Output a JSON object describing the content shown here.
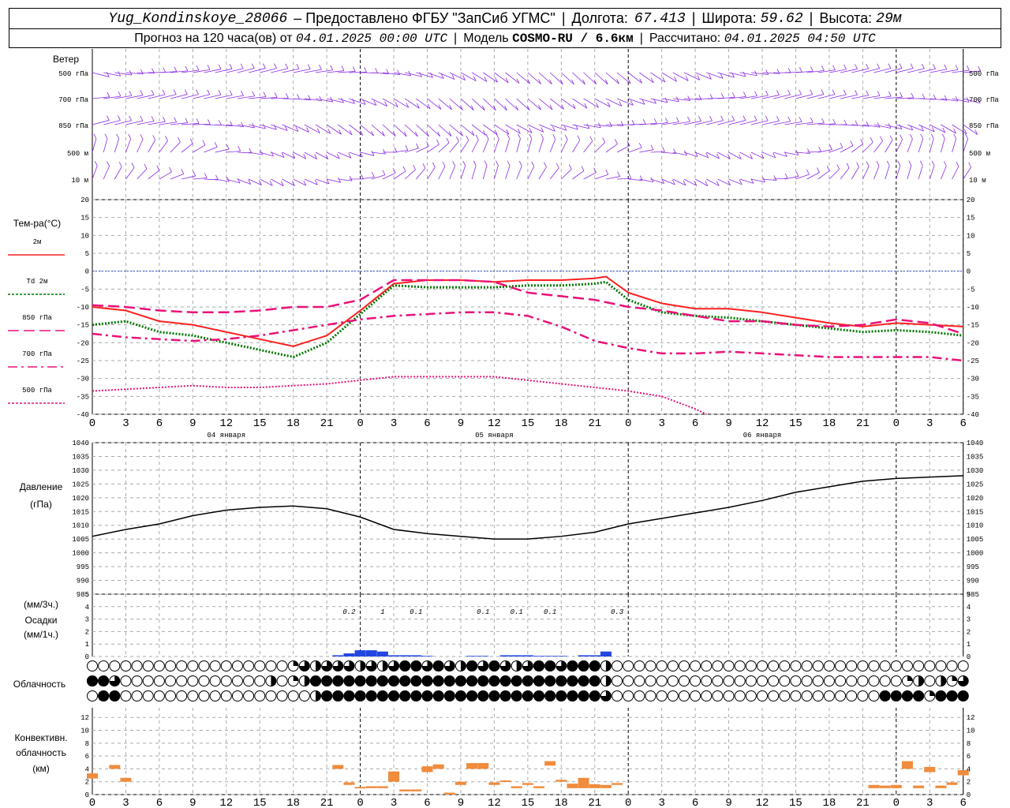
{
  "header": {
    "station": "Yug_Kondinskoye_28066",
    "provided_by": "– Предоставлено ФГБУ \"ЗапСиб УГМС\"",
    "lon_label": "Долгота:",
    "lon": "67.413",
    "lat_label": "Широта:",
    "lat": "59.62",
    "alt_label": "Высота:",
    "alt": "29м",
    "forecast_label": "Прогноз на 120 часа(ов) от",
    "forecast_from": "04.01.2025 00:00 UTC",
    "model_label": "Модель",
    "model": "COSMO-RU / 6.6км",
    "calc_label": "Рассчитано:",
    "calc_time": "04.01.2025 04:50 UTC"
  },
  "wind": {
    "title": "Ветер",
    "levels": [
      "500 гПа",
      "700 гПа",
      "850 гПа",
      "500 м",
      "10 м"
    ]
  },
  "temperature": {
    "title": "Тем-ра(°C)",
    "legend": [
      {
        "label": "2м",
        "color": "#ff2020"
      },
      {
        "label": "Td  2м",
        "color": "#007700"
      },
      {
        "label": "850 гПа",
        "color": "#e8127a"
      },
      {
        "label": "700 гПа",
        "color": "#e8127a"
      },
      {
        "label": "500 гПа",
        "color": "#e8127a"
      }
    ]
  },
  "pressure": {
    "title1": "Давление",
    "title2": "(гПа)"
  },
  "precip": {
    "title1": "(мм/3ч.)",
    "title2": "Осадки",
    "title3": "(мм/1ч.)",
    "labels": [
      {
        "h": 23,
        "text": "0.2"
      },
      {
        "h": 26,
        "text": "1"
      },
      {
        "h": 29,
        "text": "0.1"
      },
      {
        "h": 35,
        "text": "0.1"
      },
      {
        "h": 38,
        "text": "0.1"
      },
      {
        "h": 41,
        "text": "0.1"
      },
      {
        "h": 47,
        "text": "0.3"
      }
    ]
  },
  "cloud": {
    "title": "Облачность"
  },
  "convective": {
    "title1": "Конвективн.",
    "title2": "облачность",
    "title3": "(км)"
  },
  "days": [
    {
      "h": 12,
      "label": "04 января"
    },
    {
      "h": 36,
      "label": "05 января"
    },
    {
      "h": 60,
      "label": "06 января"
    }
  ],
  "x_ticks": [
    "0",
    "3",
    "6",
    "9",
    "12",
    "15",
    "18",
    "21",
    "0",
    "3",
    "6",
    "9",
    "12",
    "15",
    "18",
    "21",
    "0",
    "3",
    "6",
    "9",
    "12",
    "15",
    "18",
    "21",
    "0",
    "3",
    "6"
  ],
  "chart_data": [
    {
      "type": "line",
      "name": "temperature",
      "ylim": [
        -40,
        20
      ],
      "yticks": [
        20,
        15,
        10,
        5,
        0,
        -5,
        -10,
        -15,
        -20,
        -25,
        -30,
        -35,
        -40
      ],
      "series": [
        {
          "name": "2м",
          "color": "#ff2020",
          "style": "solid",
          "x": [
            0,
            3,
            6,
            9,
            12,
            15,
            18,
            21,
            24,
            27,
            30,
            33,
            36,
            39,
            42,
            45,
            46,
            48,
            51,
            54,
            57,
            60,
            63,
            66,
            69,
            72,
            75,
            78
          ],
          "y": [
            -10,
            -11,
            -14,
            -15,
            -17,
            -19,
            -21,
            -18,
            -11,
            -3.5,
            -2.5,
            -2.5,
            -3,
            -2.5,
            -2.5,
            -2,
            -1.5,
            -6,
            -9,
            -10.5,
            -10.5,
            -11.5,
            -13,
            -14.5,
            -15.5,
            -14.5,
            -15,
            -15.5
          ]
        },
        {
          "name": "Td 2м",
          "color": "#007700",
          "style": "dotted",
          "x": [
            0,
            3,
            6,
            9,
            12,
            15,
            18,
            21,
            24,
            27,
            30,
            33,
            36,
            39,
            42,
            45,
            46,
            48,
            51,
            54,
            57,
            60,
            63,
            66,
            69,
            72,
            75,
            78
          ],
          "y": [
            -15,
            -14,
            -17,
            -18,
            -20,
            -22,
            -24,
            -20,
            -12,
            -4,
            -4.5,
            -4.5,
            -4.5,
            -4,
            -4,
            -3.5,
            -3,
            -8,
            -11.5,
            -12.5,
            -13,
            -14,
            -15,
            -16,
            -17,
            -16.5,
            -17,
            -18
          ]
        },
        {
          "name": "850 гПа",
          "color": "#e8127a",
          "style": "longdash",
          "x": [
            0,
            3,
            6,
            9,
            12,
            15,
            18,
            21,
            24,
            27,
            30,
            33,
            36,
            39,
            42,
            45,
            48,
            51,
            54,
            57,
            60,
            63,
            66,
            69,
            72,
            75,
            78
          ],
          "y": [
            -9.5,
            -10,
            -11,
            -11.5,
            -11.5,
            -11,
            -10,
            -10,
            -8,
            -2.5,
            -2.5,
            -2.5,
            -3,
            -6,
            -7,
            -8,
            -10,
            -11,
            -12.5,
            -14,
            -14,
            -15,
            -15.5,
            -15,
            -13.5,
            -14.5,
            -17.5
          ]
        },
        {
          "name": "700 гПа",
          "color": "#e8127a",
          "style": "dashdot",
          "x": [
            0,
            3,
            6,
            9,
            12,
            15,
            18,
            21,
            24,
            27,
            30,
            33,
            36,
            39,
            42,
            45,
            48,
            51,
            54,
            57,
            60,
            63,
            66,
            69,
            72,
            75,
            78
          ],
          "y": [
            -17.5,
            -18.5,
            -19,
            -19.5,
            -19,
            -18,
            -16.5,
            -15,
            -13.5,
            -12.5,
            -12,
            -11.5,
            -11.5,
            -12.5,
            -15.5,
            -19.5,
            -21.5,
            -23,
            -23,
            -22.5,
            -23,
            -23.5,
            -24,
            -24,
            -24,
            -24,
            -25
          ]
        },
        {
          "name": "500 гПа",
          "color": "#e8127a",
          "style": "dotted",
          "x": [
            0,
            3,
            6,
            9,
            12,
            15,
            18,
            21,
            24,
            27,
            30,
            33,
            36,
            39,
            42,
            45,
            48,
            51,
            54,
            55
          ],
          "y": [
            -33.5,
            -33,
            -32.5,
            -32,
            -32.5,
            -32.5,
            -32,
            -31.5,
            -30.5,
            -29.5,
            -29.5,
            -29.5,
            -29.5,
            -30.5,
            -31.5,
            -32.5,
            -33.5,
            -35,
            -38.5,
            -40
          ]
        }
      ]
    },
    {
      "type": "line",
      "name": "pressure",
      "ylim": [
        985,
        1040
      ],
      "yticks": [
        1040,
        1035,
        1030,
        1025,
        1020,
        1015,
        1010,
        1005,
        1000,
        995,
        990,
        985
      ],
      "series": [
        {
          "name": "Давление",
          "color": "#000000",
          "x": [
            0,
            3,
            6,
            9,
            12,
            15,
            18,
            21,
            24,
            27,
            30,
            33,
            36,
            39,
            42,
            45,
            48,
            51,
            54,
            57,
            60,
            63,
            66,
            69,
            72,
            75,
            78
          ],
          "y": [
            1006,
            1008.5,
            1010.5,
            1013.5,
            1015.5,
            1016.5,
            1017,
            1016,
            1013,
            1008.5,
            1007,
            1006,
            1005,
            1005,
            1006,
            1007.5,
            1010.5,
            1012.5,
            1014.5,
            1016.5,
            1019,
            1022,
            1024,
            1026,
            1027,
            1027.5,
            1028
          ]
        }
      ]
    },
    {
      "type": "bar",
      "name": "precipitation",
      "ylim": [
        0,
        5
      ],
      "yticks": [
        5,
        4,
        3,
        2,
        1,
        0
      ],
      "color": "#2246e0",
      "series": [
        {
          "name": "Осадки",
          "x": [
            22,
            23,
            24,
            25,
            26,
            27,
            28,
            29,
            30,
            34,
            35,
            37,
            38,
            39,
            40,
            41,
            42,
            44,
            45,
            46
          ],
          "y": [
            0.1,
            0.25,
            0.5,
            0.5,
            0.4,
            0.1,
            0.1,
            0.1,
            0.05,
            0.05,
            0.05,
            0.1,
            0.1,
            0.1,
            0.05,
            0.05,
            0.05,
            0.1,
            0.1,
            0.4
          ]
        }
      ]
    },
    {
      "type": "table",
      "name": "cloudiness",
      "rows": [
        {
          "name": "высокая",
          "x_start": 0,
          "x_step": 1,
          "values": [
            0,
            0,
            0,
            0,
            0,
            0,
            0,
            0,
            0,
            0,
            0,
            0,
            0,
            0,
            0,
            0,
            0,
            0,
            1,
            3,
            2,
            3,
            3,
            3,
            2,
            3,
            2,
            3,
            4,
            4,
            3,
            4,
            3,
            2,
            4,
            3,
            4,
            3,
            2,
            3,
            4,
            4,
            3,
            4,
            4,
            4,
            2,
            0,
            0,
            0,
            0,
            0,
            0,
            0,
            0,
            0,
            0,
            0,
            0,
            0,
            0,
            0,
            0,
            0,
            0,
            0,
            0,
            0,
            0,
            0,
            0,
            0,
            0,
            0,
            0,
            0,
            0,
            0,
            0
          ]
        },
        {
          "name": "средняя",
          "x_start": 0,
          "x_step": 1,
          "values": [
            4,
            4,
            3,
            0,
            0,
            0,
            0,
            0,
            0,
            0,
            0,
            0,
            0,
            0,
            0,
            0,
            2,
            0,
            1,
            2,
            4,
            4,
            4,
            4,
            4,
            4,
            4,
            4,
            4,
            4,
            4,
            4,
            4,
            4,
            4,
            4,
            4,
            4,
            4,
            4,
            4,
            4,
            4,
            4,
            4,
            4,
            2,
            0,
            0,
            0,
            0,
            0,
            0,
            0,
            0,
            0,
            0,
            0,
            0,
            0,
            0,
            0,
            0,
            0,
            0,
            0,
            0,
            0,
            0,
            0,
            0,
            0,
            0,
            1,
            2,
            0,
            2,
            1,
            3
          ]
        },
        {
          "name": "нижняя",
          "x_start": 0,
          "x_step": 1,
          "values": [
            0,
            4,
            4,
            0,
            0,
            0,
            0,
            0,
            0,
            0,
            0,
            0,
            0,
            0,
            0,
            0,
            0,
            0,
            0,
            0,
            2,
            4,
            4,
            4,
            4,
            4,
            4,
            4,
            4,
            4,
            4,
            4,
            4,
            4,
            4,
            4,
            4,
            4,
            4,
            4,
            4,
            4,
            4,
            4,
            4,
            4,
            3,
            0,
            0,
            0,
            0,
            0,
            0,
            0,
            0,
            0,
            0,
            0,
            0,
            0,
            0,
            0,
            0,
            0,
            0,
            0,
            0,
            0,
            0,
            0,
            0,
            4,
            4,
            4,
            4,
            1,
            4,
            4,
            4
          ]
        }
      ]
    },
    {
      "type": "bar",
      "name": "convective_cloud",
      "ylim": [
        0,
        14
      ],
      "yticks": [
        12,
        10,
        8,
        6,
        4,
        2,
        0
      ],
      "color": "#f08c3c",
      "series": [
        {
          "name": "Конвективная облачность",
          "x": [
            0,
            2,
            3,
            22,
            23,
            24,
            25,
            26,
            27,
            28,
            29,
            30,
            31,
            32,
            33,
            34,
            35,
            36,
            37,
            38,
            39,
            40,
            41,
            42,
            43,
            44,
            45,
            46,
            47,
            48,
            49,
            50,
            51,
            52,
            53,
            54,
            55,
            56,
            57,
            58,
            59,
            60,
            61,
            62,
            63,
            64,
            65,
            66,
            67,
            68,
            69,
            70,
            71,
            72,
            73,
            74,
            75,
            76,
            77,
            78
          ],
          "bottom": [
            2.5,
            4,
            2,
            4,
            1.5,
            1,
            1,
            1,
            2,
            0.5,
            0.5,
            3.5,
            4,
            0,
            1.5,
            4,
            4,
            1.5,
            2,
            1,
            1.5,
            1,
            4.5,
            2,
            1,
            1,
            1,
            1,
            1.5,
            null,
            null,
            null,
            null,
            null,
            null,
            null,
            null,
            null,
            null,
            null,
            null,
            null,
            null,
            null,
            null,
            null,
            null,
            null,
            null,
            null,
            null,
            1,
            1,
            1,
            4,
            1,
            3.5,
            1,
            1.5,
            3
          ],
          "top": [
            3.3,
            4.6,
            2.6,
            4.6,
            1.9,
            1.2,
            1.3,
            1.3,
            3.6,
            0.8,
            0.8,
            4.4,
            4.7,
            0.3,
            2,
            4.9,
            4.9,
            1.9,
            2.2,
            1.3,
            1.8,
            1.3,
            5.2,
            2.3,
            1.7,
            2.6,
            1.6,
            1.5,
            1.8,
            null,
            null,
            null,
            null,
            null,
            null,
            null,
            null,
            null,
            null,
            null,
            null,
            null,
            null,
            null,
            null,
            null,
            null,
            null,
            null,
            null,
            null,
            1.5,
            1.4,
            1.5,
            5.2,
            1.4,
            4.3,
            1.4,
            1.9,
            3.8
          ]
        }
      ]
    }
  ]
}
